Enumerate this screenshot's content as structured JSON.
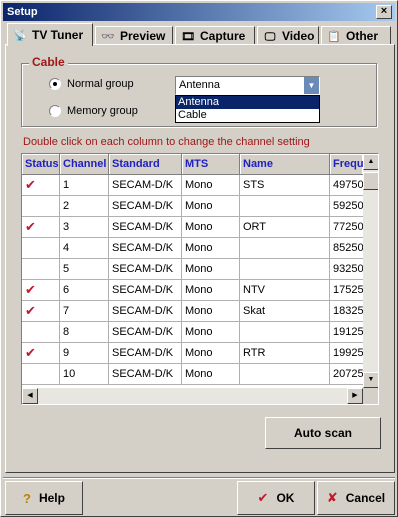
{
  "window": {
    "title": "Setup",
    "close_label": "×"
  },
  "tabs": [
    {
      "label": "TV Tuner",
      "icon": "tv-tuner-icon",
      "glyph": "📡"
    },
    {
      "label": "Preview",
      "icon": "preview-icon",
      "glyph": "👓"
    },
    {
      "label": "Capture",
      "icon": "capture-icon",
      "glyph": "🎞"
    },
    {
      "label": "Video",
      "icon": "video-icon",
      "glyph": "🖵"
    },
    {
      "label": "Other",
      "icon": "other-icon",
      "glyph": "📋"
    }
  ],
  "cable": {
    "legend": "Cable",
    "normal_group": "Normal group",
    "memory_group": "Memory group",
    "selected_radio": "normal",
    "combo_value": "Antenna",
    "options": [
      "Antenna",
      "Cable"
    ],
    "highlighted_option": "Antenna"
  },
  "hint": "Double click on each column to change the channel setting",
  "grid": {
    "columns": [
      "Status",
      "Channel",
      "Standard",
      "MTS",
      "Name",
      "Frequ"
    ],
    "rows": [
      {
        "status": true,
        "channel": "1",
        "standard": "SECAM-D/K",
        "mts": "Mono",
        "name": "STS",
        "freq": "49750"
      },
      {
        "status": false,
        "channel": "2",
        "standard": "SECAM-D/K",
        "mts": "Mono",
        "name": "",
        "freq": "59250"
      },
      {
        "status": true,
        "channel": "3",
        "standard": "SECAM-D/K",
        "mts": "Mono",
        "name": "ORT",
        "freq": "77250"
      },
      {
        "status": false,
        "channel": "4",
        "standard": "SECAM-D/K",
        "mts": "Mono",
        "name": "",
        "freq": "85250"
      },
      {
        "status": false,
        "channel": "5",
        "standard": "SECAM-D/K",
        "mts": "Mono",
        "name": "",
        "freq": "93250"
      },
      {
        "status": true,
        "channel": "6",
        "standard": "SECAM-D/K",
        "mts": "Mono",
        "name": "NTV",
        "freq": "17525"
      },
      {
        "status": true,
        "channel": "7",
        "standard": "SECAM-D/K",
        "mts": "Mono",
        "name": "Skat",
        "freq": "18325"
      },
      {
        "status": false,
        "channel": "8",
        "standard": "SECAM-D/K",
        "mts": "Mono",
        "name": "",
        "freq": "19125"
      },
      {
        "status": true,
        "channel": "9",
        "standard": "SECAM-D/K",
        "mts": "Mono",
        "name": "RTR",
        "freq": "19925"
      },
      {
        "status": false,
        "channel": "10",
        "standard": "SECAM-D/K",
        "mts": "Mono",
        "name": "",
        "freq": "20725"
      }
    ],
    "check_glyph": "✔"
  },
  "buttons": {
    "auto_scan": "Auto scan",
    "help": "Help",
    "ok": "OK",
    "cancel": "Cancel",
    "help_glyph": "?",
    "ok_glyph": "✔",
    "cancel_glyph": "✘"
  },
  "colors": {
    "title_bar": "#0a246a",
    "accent_red": "#a01818",
    "header_blue": "#2020c0",
    "check_red": "#c0182a"
  }
}
